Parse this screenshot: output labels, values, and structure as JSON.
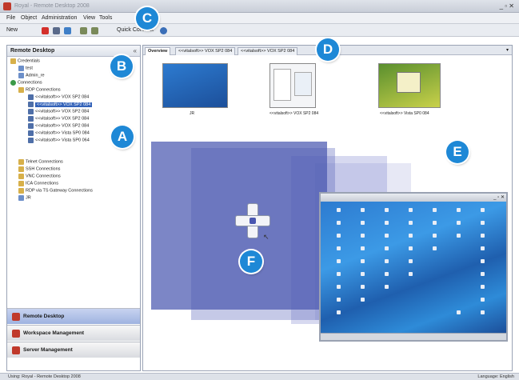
{
  "window": {
    "title": "Royal - Remote Desktop 2008"
  },
  "menu": [
    "File",
    "Object",
    "Administration",
    "View",
    "Tools"
  ],
  "toolbar": {
    "new_label": "New",
    "quick_connect_label": "Quick Connect"
  },
  "left_panel": {
    "title": "Remote Desktop",
    "tree": [
      {
        "label": "Credentials",
        "level": 0,
        "icon": "folder-icon"
      },
      {
        "label": "test",
        "level": 1,
        "icon": "user-icon"
      },
      {
        "label": "Admin_re",
        "level": 1,
        "icon": "user-icon"
      },
      {
        "label": "Connections",
        "level": 0,
        "icon": "globe-icon"
      },
      {
        "label": "RDP Connections",
        "level": 1,
        "icon": "folder-icon"
      },
      {
        "label": "<<vitalsoft>> VOX SP2 084",
        "level": 2,
        "icon": "monitor-icon"
      },
      {
        "label": "<<vitalsoft>> VOX SP2 084",
        "level": 2,
        "icon": "monitor-icon",
        "selected": true
      },
      {
        "label": "<<vitalsoft>> VOX SP2 084",
        "level": 2,
        "icon": "monitor-icon"
      },
      {
        "label": "<<vitalsoft>> VOX SP2 084",
        "level": 2,
        "icon": "monitor-icon"
      },
      {
        "label": "<<vitalsoft>> VOX SP2 084",
        "level": 2,
        "icon": "monitor-icon"
      },
      {
        "label": "<<vitalsoft>> Vista SP0 084",
        "level": 2,
        "icon": "monitor-icon"
      },
      {
        "label": "<<vitalsoft>> Vista SP0 064",
        "level": 2,
        "icon": "monitor-icon"
      },
      {
        "label": "Telnet Connections",
        "level": 1,
        "icon": "folder-icon"
      },
      {
        "label": "SSH Connections",
        "level": 1,
        "icon": "folder-icon"
      },
      {
        "label": "VNC Connections",
        "level": 1,
        "icon": "folder-icon"
      },
      {
        "label": "ICA Connections",
        "level": 1,
        "icon": "folder-icon"
      },
      {
        "label": "RDP via TS Gateway Connections",
        "level": 1,
        "icon": "folder-icon"
      },
      {
        "label": "JR",
        "level": 1,
        "icon": "user-icon"
      }
    ],
    "nav": [
      "Remote Desktop",
      "Workspace Management",
      "Server Management"
    ]
  },
  "main": {
    "tabs": [
      "Overview",
      "<<vitalsoft>> VOX SP2 084",
      "<<vitalsoft>> VOX SP2 084"
    ],
    "thumbs": [
      "JR",
      "<<vitalsoft>> VOX SP2 084",
      "<<vitalsoft>> Vista SP0 084"
    ]
  },
  "callouts": [
    "A",
    "B",
    "C",
    "D",
    "E",
    "F"
  ],
  "status": {
    "left": "Using: Royal - Remote Desktop 2008",
    "right": "Language: English"
  },
  "colors": {
    "accent": "#1e88d6",
    "selection": "#3463b9",
    "plane": "#4a57b0"
  }
}
